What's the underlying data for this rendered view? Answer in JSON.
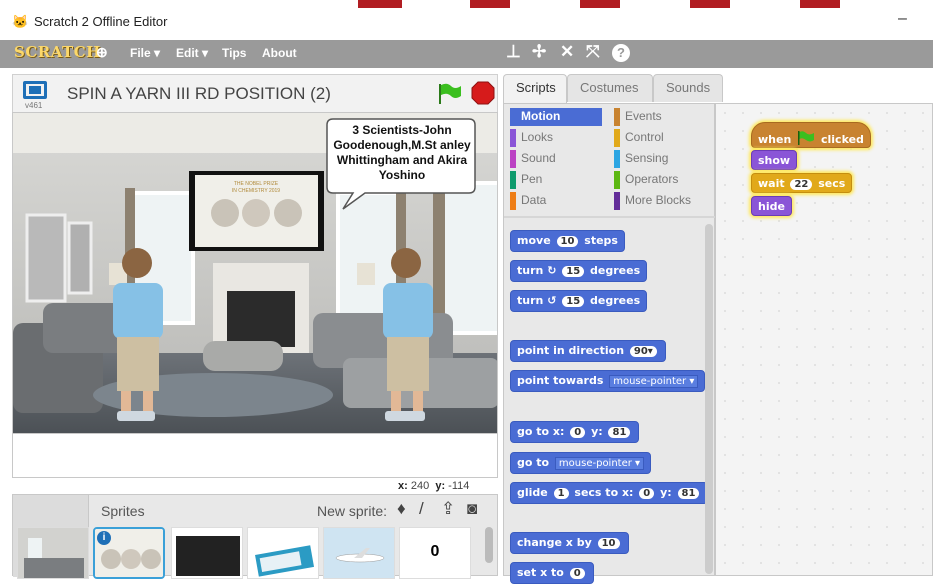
{
  "window": {
    "app_icon": "scratch-cat-icon",
    "title": "Scratch 2 Offline Editor",
    "minimize": "–"
  },
  "menubar": {
    "logo": "SCRATCH",
    "globe_icon": "globe-icon",
    "file": "File ▾",
    "edit": "Edit ▾",
    "tips": "Tips",
    "about": "About",
    "tools": [
      "duplicate-icon",
      "delete-icon",
      "grow-icon",
      "shrink-icon",
      "help-icon"
    ],
    "tool_glyphs": [
      "⊥",
      "✢",
      "✕",
      "⤧",
      "?"
    ]
  },
  "stage_header": {
    "version": "v461",
    "project_name": "SPIN A YARN III RD POSITION (2)"
  },
  "stage": {
    "speech_bubble": "3 Scientists-John Goodenough,M.St anley Whittingham and Akira Yoshino",
    "tv_caption_1": "THE NOBEL PRIZE",
    "tv_caption_2": "IN CHEMISTRY 2019"
  },
  "coords": {
    "x_label": "x:",
    "x_value": "240",
    "y_label": "y:",
    "y_value": "-114"
  },
  "sprites_panel": {
    "label": "Sprites",
    "new_sprite_label": "New sprite:",
    "tools": [
      "paint-from-library-icon",
      "paintbrush-icon",
      "upload-icon",
      "camera-icon"
    ],
    "tool_glyphs": [
      "♦",
      "/",
      "⇪",
      "◙"
    ],
    "zero_thumb": "0",
    "info_badge": "i"
  },
  "tabs": [
    "Scripts",
    "Costumes",
    "Sounds"
  ],
  "categories": [
    {
      "label": "Motion",
      "color": "#4a6cd4"
    },
    {
      "label": "Looks",
      "color": "#8a55d7"
    },
    {
      "label": "Sound",
      "color": "#bb42c3"
    },
    {
      "label": "Pen",
      "color": "#0e9a6c"
    },
    {
      "label": "Data",
      "color": "#ee7d16"
    },
    {
      "label": "Events",
      "color": "#c88330"
    },
    {
      "label": "Control",
      "color": "#e1a91a"
    },
    {
      "label": "Sensing",
      "color": "#2ca5e2"
    },
    {
      "label": "Operators",
      "color": "#5cb712"
    },
    {
      "label": "More Blocks",
      "color": "#632d99"
    }
  ],
  "palette_blocks": {
    "move": {
      "a": "move",
      "n": "10",
      "b": "steps"
    },
    "turn_cw": {
      "a": "turn",
      "icon": "↻",
      "n": "15",
      "b": "degrees"
    },
    "turn_ccw": {
      "a": "turn",
      "icon": "↺",
      "n": "15",
      "b": "degrees"
    },
    "point_dir": {
      "a": "point in direction",
      "n": "90▾"
    },
    "point_towards": {
      "a": "point towards",
      "dd": "mouse-pointer ▾"
    },
    "goto_xy": {
      "a": "go to x:",
      "x": "0",
      "b": "y:",
      "y": "81"
    },
    "goto": {
      "a": "go to",
      "dd": "mouse-pointer ▾"
    },
    "glide": {
      "a": "glide",
      "n": "1",
      "b": "secs to x:",
      "x": "0",
      "c": "y:",
      "y": "81"
    },
    "change_x": {
      "a": "change x by",
      "n": "10"
    },
    "set_x": {
      "a": "set x to",
      "n": "0"
    }
  },
  "script": {
    "when": "when",
    "clicked": "clicked",
    "show": "show",
    "wait": "wait",
    "wait_value": "22",
    "secs": "secs",
    "hide": "hide"
  },
  "colors": {
    "motion": "#4a6cd4",
    "menubar": "#9a9a9a",
    "events": "#c88330",
    "looks": "#8a55d7",
    "control": "#e1a91a"
  }
}
